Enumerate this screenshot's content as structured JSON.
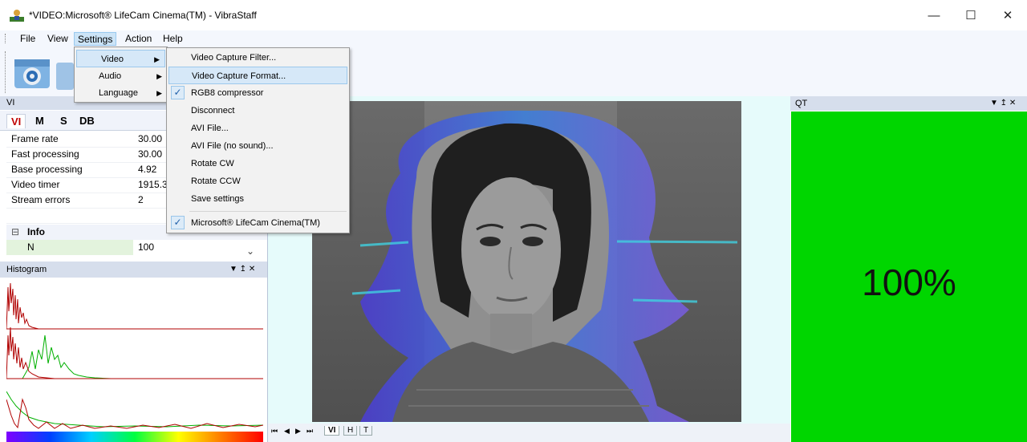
{
  "window": {
    "title": "*VIDEO:Microsoft® LifeCam Cinema(TM) - VibraStaff",
    "minimize": "—",
    "maximize": "☐",
    "close": "✕"
  },
  "menubar": {
    "items": [
      "File",
      "View",
      "Settings",
      "Action",
      "Help"
    ]
  },
  "settings_menu": {
    "items": [
      {
        "label": "Video",
        "has_submenu": true,
        "highlighted": true
      },
      {
        "label": "Audio",
        "has_submenu": true
      },
      {
        "label": "Language",
        "has_submenu": true
      }
    ]
  },
  "video_submenu": {
    "items": [
      {
        "label": "Video Capture Filter..."
      },
      {
        "label": "Video Capture Format...",
        "highlighted": true
      },
      {
        "label": "RGB8 compressor",
        "checked": true
      },
      {
        "label": "Disconnect"
      },
      {
        "label": "AVI File..."
      },
      {
        "label": "AVI File (no sound)..."
      },
      {
        "label": "Rotate CW"
      },
      {
        "label": "Rotate CCW"
      },
      {
        "label": "Save settings"
      },
      {
        "label": "Microsoft® LifeCam Cinema(TM)",
        "checked": true
      }
    ]
  },
  "vi_panel": {
    "title": "VI",
    "tabs": [
      "VI",
      "M",
      "S",
      "DB"
    ],
    "active_tab": "VI",
    "properties": [
      {
        "name": "Frame rate",
        "value": "30.00"
      },
      {
        "name": "Fast processing",
        "value": "30.00"
      },
      {
        "name": "Base processing",
        "value": "4.92"
      },
      {
        "name": "Video timer",
        "value": "1915.3"
      },
      {
        "name": "Stream errors",
        "value": "2"
      }
    ],
    "info_section": {
      "label": "Info",
      "expander": "⊟"
    },
    "info_rows": [
      {
        "name": "N",
        "value": "100"
      }
    ]
  },
  "histogram_panel": {
    "title": "Histogram",
    "controls": "▼ ↥ ✕"
  },
  "video_nav": {
    "buttons": [
      "⏮",
      "◀",
      "▶",
      "⏭"
    ],
    "tabs": [
      "VI",
      "H",
      "T"
    ],
    "active_tab": "VI"
  },
  "qt_panel": {
    "title": "QT",
    "controls": "▼ ↥ ✕",
    "value": "100%",
    "background": "#00d600"
  },
  "colors": {
    "panel_header": "#d6deec",
    "menu_highlight": "#cce4f7",
    "video_bg": "#e6fbfb",
    "qt_green": "#00d600"
  }
}
